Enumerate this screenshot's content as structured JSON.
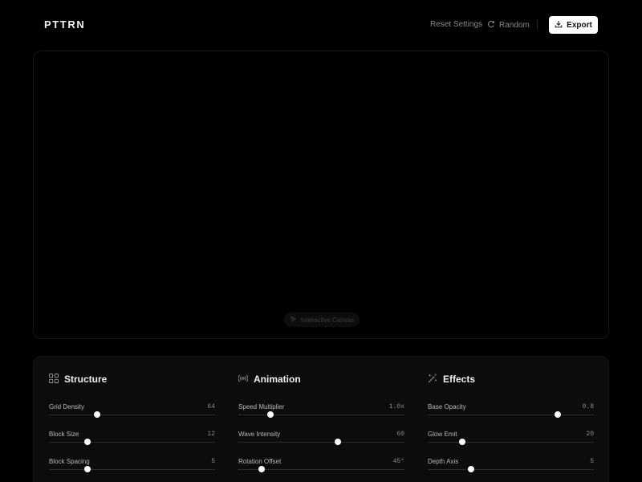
{
  "app": {
    "logo": "PTTRN",
    "reset_label": "Reset Settings",
    "random_label": "Random",
    "export_label": "Export",
    "accent_color": "#ffffff",
    "background_color": "#000000"
  },
  "canvas": {
    "badge_label": "Interactive Canvas",
    "badge_icon": "pointer-click-icon"
  },
  "panel": {
    "sections": [
      {
        "title": "Structure",
        "icon": "grid-icon",
        "controls": [
          {
            "label": "Grid Density",
            "value": "64",
            "fraction": 0.29
          },
          {
            "label": "Block Size",
            "value": "12",
            "fraction": 0.23
          },
          {
            "label": "Block Spacing",
            "value": "5",
            "fraction": 0.23
          }
        ]
      },
      {
        "title": "Animation",
        "icon": "broadcast-icon",
        "controls": [
          {
            "label": "Speed Multiplier",
            "value": "1.0x",
            "fraction": 0.195
          },
          {
            "label": "Wave Intensity",
            "value": "60",
            "fraction": 0.6
          },
          {
            "label": "Rotation Offset",
            "value": "45°",
            "fraction": 0.14
          }
        ]
      },
      {
        "title": "Effects",
        "icon": "sparkle-wand-icon",
        "controls": [
          {
            "label": "Base Opacity",
            "value": "0.8",
            "fraction": 0.785
          },
          {
            "label": "Glow Emit",
            "value": "20",
            "fraction": 0.21
          },
          {
            "label": "Depth Axis",
            "value": "5",
            "fraction": 0.26
          }
        ]
      }
    ]
  }
}
